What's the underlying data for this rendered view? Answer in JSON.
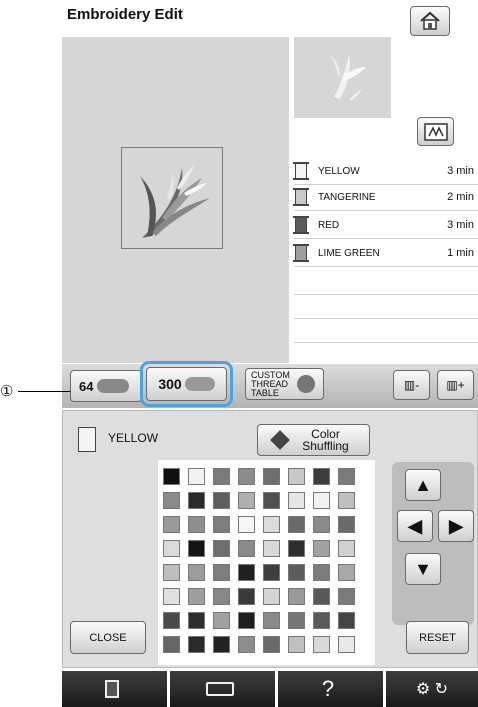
{
  "header": {
    "title": "Embroidery Edit",
    "home_icon": "home-icon"
  },
  "threads": [
    {
      "name": "YELLOW",
      "time": "3 min",
      "color": "#f4f4f4"
    },
    {
      "name": "TANGERINE",
      "time": "2 min",
      "color": "#c9c9c9"
    },
    {
      "name": "RED",
      "time": "3 min",
      "color": "#5a5a5a"
    },
    {
      "name": "LIME GREEN",
      "time": "1 min",
      "color": "#9e9e9e"
    }
  ],
  "toolbar": {
    "palette64_label": "64",
    "palette300_label": "300",
    "custom_table_label": "CUSTOM THREAD TABLE",
    "callout_number": "①"
  },
  "editor": {
    "selected_thread": "YELLOW",
    "color_shuffling_label": "Color Shuffling",
    "close_label": "CLOSE",
    "reset_label": "RESET"
  },
  "bottom_bar": {
    "help_label": "?"
  },
  "palette_grid": [
    [
      "#111111",
      "#f2f2f2",
      "#7a7a7a",
      "#8c8c8c",
      "#6e6e6e",
      "#c8c8c8",
      "#3c3c3c",
      "#7a7a7a"
    ],
    [
      "#8a8a8a",
      "#2a2a2a",
      "#5e5e5e",
      "#b0b0b0",
      "#505050",
      "#e6e6e6",
      "#f2f2f2",
      "#bfbfbf"
    ],
    [
      "#9a9a9a",
      "#8e8e8e",
      "#7e7e7e",
      "#f6f6f6",
      "#dcdcdc",
      "#6a6a6a",
      "#8a8a8a",
      "#6a6a6a"
    ],
    [
      "#dadada",
      "#141414",
      "#6e6e6e",
      "#8a8a8a",
      "#d8d8d8",
      "#2e2e2e",
      "#a2a2a2",
      "#d0d0d0"
    ],
    [
      "#bdbdbd",
      "#9c9c9c",
      "#7e7e7e",
      "#202020",
      "#3e3e3e",
      "#5c5c5c",
      "#7c7c7c",
      "#a8a8a8"
    ],
    [
      "#e0e0e0",
      "#9e9e9e",
      "#888888",
      "#3a3a3a",
      "#d4d4d4",
      "#9a9a9a",
      "#585858",
      "#7a7a7a"
    ],
    [
      "#4a4a4a",
      "#2e2e2e",
      "#a0a0a0",
      "#1e1e1e",
      "#8a8a8a",
      "#767676",
      "#5a5a5a",
      "#454545"
    ],
    [
      "#666666",
      "#2a2a2a",
      "#222222",
      "#8e8e8e",
      "#6a6a6a",
      "#c0c0c0",
      "#d8d8d8",
      "#e8e8e8"
    ]
  ]
}
